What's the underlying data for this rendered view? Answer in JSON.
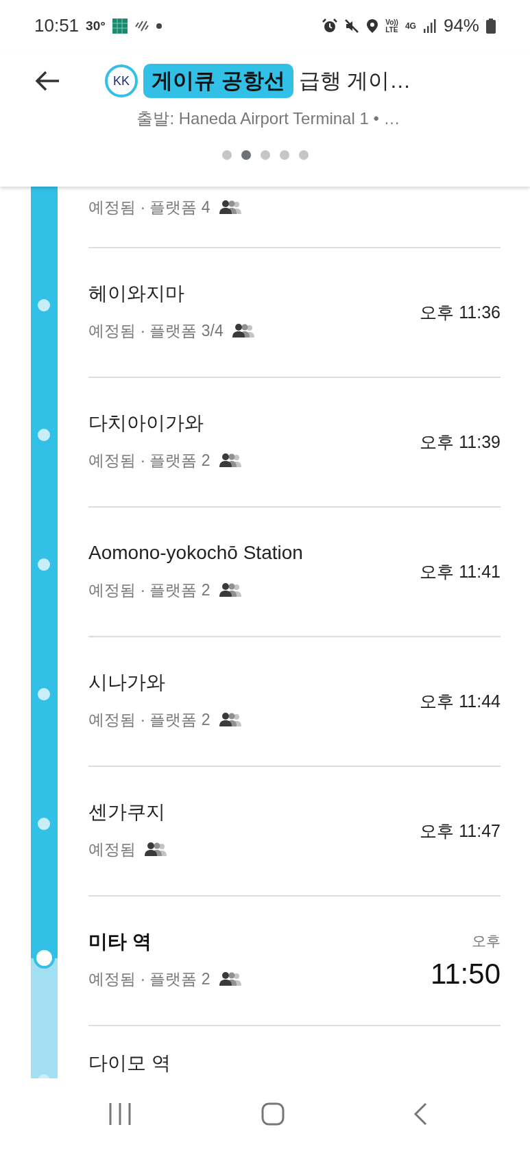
{
  "status_bar": {
    "time": "10:51",
    "temperature": "30°",
    "network_texts": [
      "Vo))",
      "LTE",
      "4G"
    ],
    "battery": "94%"
  },
  "header": {
    "logo": "KK",
    "line_badge": "게이큐 공항선",
    "title": "급행 게이…",
    "subtitle": "출발: Haneda Airport Terminal 1 • …",
    "pages": [
      {
        "selected": false
      },
      {
        "selected": true
      },
      {
        "selected": false
      },
      {
        "selected": false
      },
      {
        "selected": false
      }
    ]
  },
  "stations": [
    {
      "details": "예정됨 · 플랫폼 4"
    },
    {
      "name": "헤이와지마",
      "details": "예정됨 · 플랫폼 3/4",
      "time": "오후 11:36",
      "current": false
    },
    {
      "name": "다치아이가와",
      "details": "예정됨 · 플랫폼 2",
      "time": "오후 11:39",
      "current": false
    },
    {
      "name": "Aomono-yokochō Station",
      "details": "예정됨 · 플랫폼 2",
      "time": "오후 11:41",
      "current": false
    },
    {
      "name": "시나가와",
      "details": "예정됨 · 플랫폼 2",
      "time": "오후 11:44",
      "current": false
    },
    {
      "name": "센가쿠지",
      "details": "예정됨",
      "time": "오후 11:47",
      "current": false
    },
    {
      "name": "미타 역",
      "details": "예정됨 · 플랫폼 2",
      "period": "오후",
      "time": "11:50",
      "current": true
    },
    {
      "name": "다이모 역",
      "current": false
    }
  ]
}
